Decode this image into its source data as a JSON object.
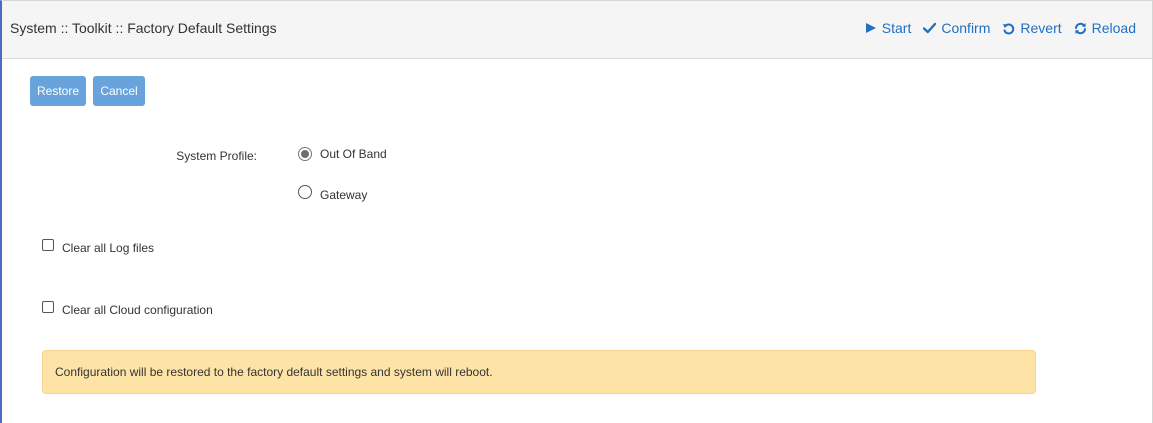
{
  "header": {
    "title": "System :: Toolkit :: Factory Default Settings",
    "actions": [
      {
        "label": "Start",
        "icon": "play-icon"
      },
      {
        "label": "Confirm",
        "icon": "check-icon"
      },
      {
        "label": "Revert",
        "icon": "undo-icon"
      },
      {
        "label": "Reload",
        "icon": "refresh-icon"
      }
    ]
  },
  "buttons": {
    "restore_label": "Restore",
    "cancel_label": "Cancel"
  },
  "form": {
    "profile_label": "System Profile:",
    "profile_options": [
      {
        "label": "Out Of Band",
        "selected": true
      },
      {
        "label": "Gateway",
        "selected": false
      }
    ],
    "checkboxes": [
      {
        "label": "Clear all Log files",
        "checked": false
      },
      {
        "label": "Clear all Cloud configuration",
        "checked": false
      }
    ]
  },
  "alert": {
    "message": "Configuration will be restored to the factory default settings and system will reboot."
  },
  "colors": {
    "accent": "#1f6fc3",
    "button": "#68a3dc",
    "warning_bg": "#fee3a6",
    "left_border": "#4f6bbf"
  }
}
